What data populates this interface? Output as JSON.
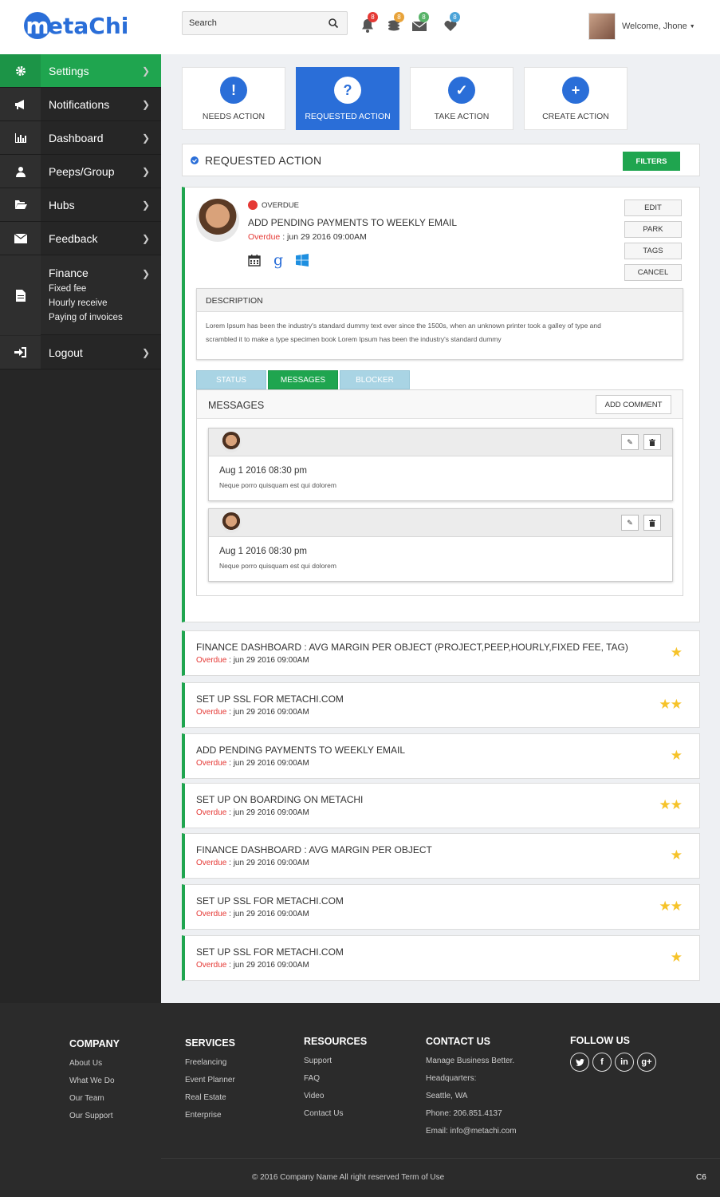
{
  "header": {
    "logo": "MetaChi",
    "search_placeholder": "Search",
    "badges": {
      "notifications": "8",
      "coins": "8",
      "messages": "8",
      "likes": "8"
    },
    "welcome": "Welcome, Jhone"
  },
  "sidebar": {
    "items": [
      {
        "label": "Settings"
      },
      {
        "label": "Notifications"
      },
      {
        "label": "Dashboard"
      },
      {
        "label": "Peeps/Group"
      },
      {
        "label": "Hubs"
      },
      {
        "label": "Feedback"
      },
      {
        "label": "Finance"
      },
      {
        "label": "Logout"
      }
    ],
    "finance_sub": [
      "Fixed fee",
      "Hourly receive",
      "Paying of invoices"
    ]
  },
  "action_tabs": [
    {
      "label": "NEEDS ACTION",
      "icon": "!"
    },
    {
      "label": "REQUESTED ACTION",
      "icon": "?"
    },
    {
      "label": "TAKE ACTION",
      "icon": "✓"
    },
    {
      "label": "CREATE ACTION",
      "icon": "+"
    }
  ],
  "section": {
    "title": "REQUESTED ACTION",
    "filters": "FILTERS"
  },
  "card": {
    "status": "OVERDUE",
    "title": "ADD PENDING PAYMENTS TO WEEKLY EMAIL",
    "due_label": "Overdue",
    "due_sep": " : ",
    "due_date": "jun 29 2016 09:00AM",
    "buttons": [
      "EDIT",
      "PARK",
      "TAGS",
      "CANCEL"
    ],
    "description_title": "DESCRIPTION",
    "description_line1": "Lorem Ipsum has been the industry's standard dummy text ever since the 1500s, when an unknown printer took a galley of type and",
    "description_line2": "scrambled it to make a type specimen book Lorem Ipsum has been the industry's standard dummy",
    "tabs": [
      "STATUS",
      "MESSAGES",
      "BLOCKER"
    ],
    "messages_title": "MESSAGES",
    "add_comment": "ADD COMMENT",
    "messages": [
      {
        "date": "Aug 1 2016  08:30 pm",
        "text": "Neque porro quisquam est qui dolorem"
      },
      {
        "date": "Aug 1 2016  08:30 pm",
        "text": "Neque porro quisquam est qui dolorem"
      }
    ]
  },
  "tasks": [
    {
      "title": "FINANCE DASHBOARD : AVG MARGIN PER OBJECT (PROJECT,PEEP,HOURLY,FIXED FEE, TAG)",
      "due_label": "Overdue",
      "date": "jun 29 2016 09:00AM",
      "stars": "★"
    },
    {
      "title": "SET UP SSL FOR METACHI.COM",
      "due_label": "Overdue",
      "date": "jun 29 2016 09:00AM",
      "stars": "★★"
    },
    {
      "title": "ADD PENDING PAYMENTS TO WEEKLY EMAIL",
      "due_label": "Overdue",
      "date": "jun 29 2016 09:00AM",
      "stars": "★"
    },
    {
      "title": "SET UP ON BOARDING ON METACHI",
      "due_label": "Overdue",
      "date": "jun 29 2016 09:00AM",
      "stars": "★★"
    },
    {
      "title": "FINANCE DASHBOARD : AVG MARGIN PER OBJECT",
      "due_label": "Overdue",
      "date": "jun 29 2016 09:00AM",
      "stars": "★"
    },
    {
      "title": "SET UP SSL FOR METACHI.COM",
      "due_label": "Overdue",
      "date": "jun 29 2016 09:00AM",
      "stars": "★★"
    },
    {
      "title": "SET UP SSL FOR METACHI.COM",
      "due_label": "Overdue",
      "date": "jun 29 2016 09:00AM",
      "stars": "★"
    }
  ],
  "footer": {
    "company": {
      "title": "COMPANY",
      "links": [
        "About Us",
        "What We Do",
        "Our Team",
        "Our Support"
      ]
    },
    "services": {
      "title": "SERVICES",
      "links": [
        "Freelancing",
        "Event Planner",
        "Real Estate",
        "Enterprise"
      ]
    },
    "resources": {
      "title": "RESOURCES",
      "links": [
        "Support",
        "FAQ",
        "Video",
        "Contact Us"
      ]
    },
    "contact": {
      "title": "CONTACT US",
      "lines": [
        "Manage Business Better.",
        "Headquarters:",
        "Seattle, WA",
        "Phone: 206.851.4137",
        "Email: info@metachi.com"
      ]
    },
    "follow": {
      "title": "FOLLOW US"
    },
    "copyright": "© 2016 Company Name  All right reserved  Term of Use",
    "version": "C6"
  },
  "colors": {
    "green": "#1fa54f",
    "blue": "#2a6ed8",
    "red": "#e53935",
    "star": "#f6c32a"
  }
}
